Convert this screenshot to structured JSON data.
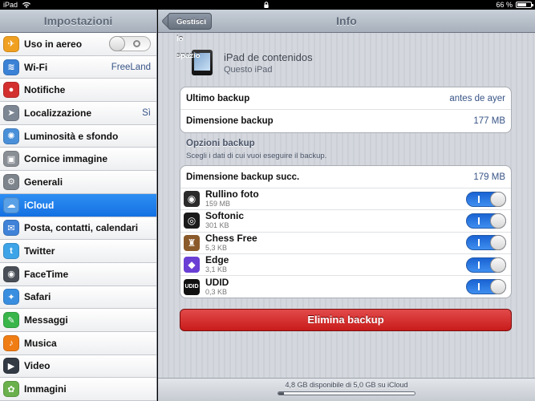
{
  "status_bar": {
    "device": "iPad",
    "battery_text": "66 %",
    "battery_level": 0.66
  },
  "sidebar": {
    "title": "Impostazioni",
    "items": [
      {
        "label": "Uso in aereo",
        "icon": "airplane-icon",
        "color": "#f0a020",
        "toggle": "off",
        "value": ""
      },
      {
        "label": "Wi-Fi",
        "icon": "wifi-icon",
        "color": "#3b82d6",
        "value": "FreeLand"
      },
      {
        "label": "Notifiche",
        "icon": "notifications-icon",
        "color": "#d32f2f",
        "value": ""
      },
      {
        "label": "Localizzazione",
        "icon": "location-icon",
        "color": "#7d8794",
        "value": "Sì"
      },
      {
        "label": "Luminosità e sfondo",
        "icon": "brightness-icon",
        "color": "#4a90d9",
        "value": ""
      },
      {
        "label": "Cornice immagine",
        "icon": "picture-frame-icon",
        "color": "#8a8f96",
        "value": ""
      },
      {
        "label": "Generali",
        "icon": "gear-icon",
        "color": "#7e848c",
        "value": ""
      },
      {
        "label": "iCloud",
        "icon": "cloud-icon",
        "color": "#5aa0e6",
        "value": ""
      },
      {
        "label": "Posta, contatti, calendari",
        "icon": "mail-icon",
        "color": "#3f82d8",
        "value": ""
      },
      {
        "label": "Twitter",
        "icon": "twitter-icon",
        "color": "#3ea4e8",
        "value": ""
      },
      {
        "label": "FaceTime",
        "icon": "facetime-icon",
        "color": "#4a4f57",
        "value": ""
      },
      {
        "label": "Safari",
        "icon": "safari-icon",
        "color": "#3a8ee0",
        "value": ""
      },
      {
        "label": "Messaggi",
        "icon": "messages-icon",
        "color": "#39b54a",
        "value": ""
      },
      {
        "label": "Musica",
        "icon": "music-icon",
        "color": "#f07d14",
        "value": ""
      },
      {
        "label": "Video",
        "icon": "video-icon",
        "color": "#333a44",
        "value": ""
      },
      {
        "label": "Immagini",
        "icon": "photos-icon",
        "color": "#6ab04c",
        "value": ""
      }
    ],
    "selected_index": 7
  },
  "navbar": {
    "back_label": "Gestisci lo spazio",
    "title": "Info"
  },
  "device": {
    "name": "iPad de contenidos",
    "subtitle": "Questo iPad"
  },
  "backup_info": {
    "last_backup_label": "Ultimo backup",
    "last_backup_value": "antes de ayer",
    "size_label": "Dimensione backup",
    "size_value": "177 MB"
  },
  "options": {
    "title": "Opzioni backup",
    "subtitle": "Scegli i dati di cui vuoi eseguire il backup.",
    "next_size_label": "Dimensione backup succ.",
    "next_size_value": "179 MB",
    "apps": [
      {
        "name": "Rullino foto",
        "size": "159 MB",
        "icon": "camera-roll-icon",
        "color": "#2b2b2b",
        "glyph": "",
        "enabled": true
      },
      {
        "name": "Softonic",
        "size": "301 KB",
        "icon": "softonic-icon",
        "color": "#1a1a1a",
        "glyph": "",
        "enabled": true
      },
      {
        "name": "Chess Free",
        "size": "5,3 KB",
        "icon": "chess-icon",
        "color": "#8b5a2b",
        "glyph": "",
        "enabled": true
      },
      {
        "name": "Edge",
        "size": "3,1 KB",
        "icon": "edge-icon",
        "color": "#6a3fd4",
        "glyph": "",
        "enabled": true
      },
      {
        "name": "UDID",
        "size": "0,3 KB",
        "icon": "udid-icon",
        "color": "#111111",
        "glyph": "UDID",
        "enabled": true
      }
    ]
  },
  "delete_button": {
    "label": "Elimina backup",
    "color": "#c91b1b"
  },
  "storage": {
    "text": "4,8 GB disponibile di 5,0 GB su iCloud",
    "used_fraction": 0.04
  }
}
